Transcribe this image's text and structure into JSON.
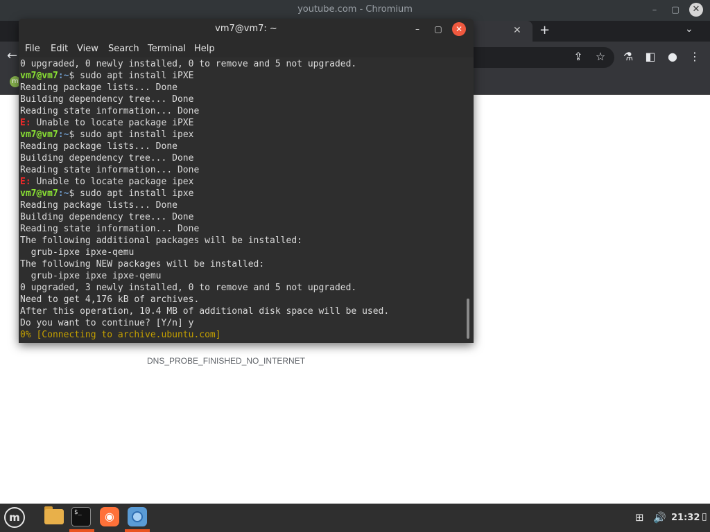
{
  "chromium": {
    "window_title": "youtube.com - Chromium",
    "minimize": "–",
    "maximize": "▢",
    "close": "✕",
    "tab_close": "✕",
    "new_tab": "+",
    "tab_search": "⌄",
    "back": "←",
    "share": "⇪",
    "bookmark_star": "☆",
    "labs": "⚗",
    "side_panel": "◧",
    "profile": "●",
    "more_menu": "⋮",
    "bookmark_favicon": "m",
    "error_code": "DNS_PROBE_FINISHED_NO_INTERNET"
  },
  "terminal": {
    "title": "vm7@vm7: ~",
    "minimize": "–",
    "maximize": "▢",
    "close": "✕",
    "menu": [
      "File",
      "Edit",
      "View",
      "Search",
      "Terminal",
      "Help"
    ],
    "prompt_user": "vm7@vm7",
    "prompt_path": ":~",
    "prompt_symbol": "$ ",
    "error_prefix": "E:",
    "lines": [
      {
        "text": "0 upgraded, 0 newly installed, 0 to remove and 5 not upgraded."
      },
      {
        "cmd": "sudo apt install iPXE"
      },
      {
        "text": "Reading package lists... Done"
      },
      {
        "text": "Building dependency tree... Done"
      },
      {
        "text": "Reading state information... Done"
      },
      {
        "err": " Unable to locate package iPXE"
      },
      {
        "cmd": "sudo apt install ipex"
      },
      {
        "text": "Reading package lists... Done"
      },
      {
        "text": "Building dependency tree... Done"
      },
      {
        "text": "Reading state information... Done"
      },
      {
        "err": " Unable to locate package ipex"
      },
      {
        "cmd": "sudo apt install ipxe"
      },
      {
        "text": "Reading package lists... Done"
      },
      {
        "text": "Building dependency tree... Done"
      },
      {
        "text": "Reading state information... Done"
      },
      {
        "text": "The following additional packages will be installed:"
      },
      {
        "text": "  grub-ipxe ipxe-qemu"
      },
      {
        "text": "The following NEW packages will be installed:"
      },
      {
        "text": "  grub-ipxe ipxe ipxe-qemu"
      },
      {
        "text": "0 upgraded, 3 newly installed, 0 to remove and 5 not upgraded."
      },
      {
        "text": "Need to get 4,176 kB of archives."
      },
      {
        "text": "After this operation, 10.4 MB of additional disk space will be used."
      },
      {
        "text": "Do you want to continue? [Y/n] y"
      },
      {
        "progress": "0% [Connecting to archive.ubuntu.com]"
      }
    ]
  },
  "taskbar": {
    "menu_logo": "m",
    "terminal_glyph": "$_",
    "firefox_glyph": "◉",
    "network_icon": "⊞",
    "volume_icon": "🔊",
    "clock": "21:32",
    "more": "▯"
  }
}
